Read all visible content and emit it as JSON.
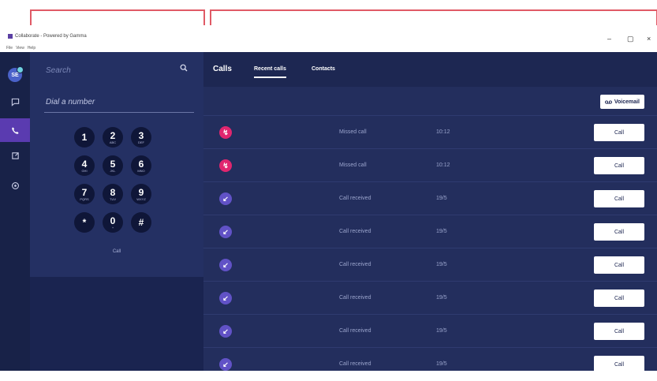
{
  "window": {
    "title": "Collaborate - Powered by Gamma",
    "menu": [
      "File",
      "View",
      "Help"
    ],
    "controls": {
      "minimize": "–",
      "maximize": "▢",
      "close": "×"
    }
  },
  "rail": {
    "avatar_initials": "SE",
    "items": [
      {
        "icon": "chat-icon"
      },
      {
        "icon": "phone-icon",
        "active": true
      },
      {
        "icon": "share-icon"
      },
      {
        "icon": "settings-icon"
      }
    ]
  },
  "dialer": {
    "search_placeholder": "Search",
    "dial_placeholder": "Dial a number",
    "keys": [
      {
        "digit": "1",
        "letters": ""
      },
      {
        "digit": "2",
        "letters": "ABC"
      },
      {
        "digit": "3",
        "letters": "DEF"
      },
      {
        "digit": "4",
        "letters": "GHI"
      },
      {
        "digit": "5",
        "letters": "JKL"
      },
      {
        "digit": "6",
        "letters": "MNO"
      },
      {
        "digit": "7",
        "letters": "PQRS"
      },
      {
        "digit": "8",
        "letters": "TUV"
      },
      {
        "digit": "9",
        "letters": "WXYZ"
      },
      {
        "digit": "*",
        "letters": ""
      },
      {
        "digit": "0",
        "letters": "+"
      },
      {
        "digit": "#",
        "letters": ""
      }
    ],
    "call_label": "Call"
  },
  "main": {
    "title": "Calls",
    "tabs": [
      "Recent calls",
      "Contacts"
    ],
    "voicemail_label": "Voicemail",
    "call_button_label": "Call",
    "rows": [
      {
        "type": "missed",
        "status": "Missed call",
        "time": "10:12"
      },
      {
        "type": "missed",
        "status": "Missed call",
        "time": "10:12"
      },
      {
        "type": "received",
        "status": "Call received",
        "time": "19/5"
      },
      {
        "type": "received",
        "status": "Call received",
        "time": "19/5"
      },
      {
        "type": "received",
        "status": "Call received",
        "time": "19/5"
      },
      {
        "type": "received",
        "status": "Call received",
        "time": "19/5"
      },
      {
        "type": "received",
        "status": "Call received",
        "time": "19/5"
      },
      {
        "type": "received",
        "status": "Call received",
        "time": "19/5"
      }
    ]
  },
  "colors": {
    "missed": "#e0266f",
    "received": "#6152c6",
    "accent": "#5a3bb0"
  }
}
